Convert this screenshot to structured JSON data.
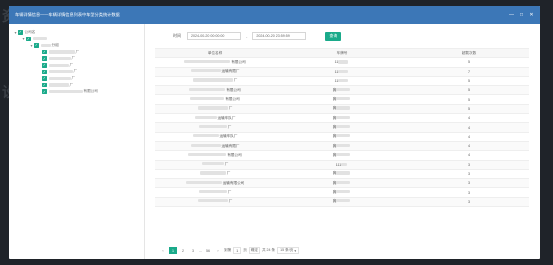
{
  "background_text": [
    "资",
    "设"
  ],
  "window": {
    "title": "车辆详情信息——车辆详情信息列表中车型分类统计数据",
    "icons": [
      "minimize-icon",
      "maximize-icon",
      "close-icon"
    ]
  },
  "tree": {
    "root_label": "公司名",
    "group_label": "分组",
    "children": [
      "厂",
      "厂",
      "厂",
      "厂",
      "厂",
      "厂",
      "有限公司"
    ]
  },
  "filter": {
    "time_label": "时间",
    "start": "2024-00-20 00:00:00",
    "separator": "-",
    "end": "2024-00-20 23:59:59",
    "query_label": "查询"
  },
  "table": {
    "headers": [
      "单位名称",
      "车牌号",
      "超载次数"
    ],
    "rows": [
      [
        "有限公司",
        "11",
        "5"
      ],
      [
        "运输有限厂",
        "11",
        "7"
      ],
      [
        "厂",
        "11",
        "5"
      ],
      [
        "有限公司",
        "冀",
        "5"
      ],
      [
        "有限公司",
        "冀",
        "5"
      ],
      [
        "厂",
        "冀",
        "5"
      ],
      [
        "运输车队厂",
        "冀",
        "4"
      ],
      [
        "厂",
        "冀",
        "4"
      ],
      [
        "运输车队厂",
        "冀",
        "4"
      ],
      [
        "运输有限厂",
        "冀",
        "4"
      ],
      [
        "有限公司",
        "冀",
        "4"
      ],
      [
        "厂",
        "111",
        "3"
      ],
      [
        "厂",
        "冀",
        "3"
      ],
      [
        "运输有限公司",
        "冀",
        "3"
      ],
      [
        "厂",
        "冀",
        "3"
      ],
      [
        "厂",
        "冀",
        "3"
      ]
    ]
  },
  "pager": {
    "prev": "‹",
    "pages": [
      "1",
      "2",
      "3"
    ],
    "ellipsis": "...",
    "last": "56",
    "next": "›",
    "goto_prefix": "到第",
    "goto_value": "1",
    "goto_suffix": "页",
    "confirm": "确定",
    "total": "共 24 条",
    "per_page": "15 条/页"
  }
}
